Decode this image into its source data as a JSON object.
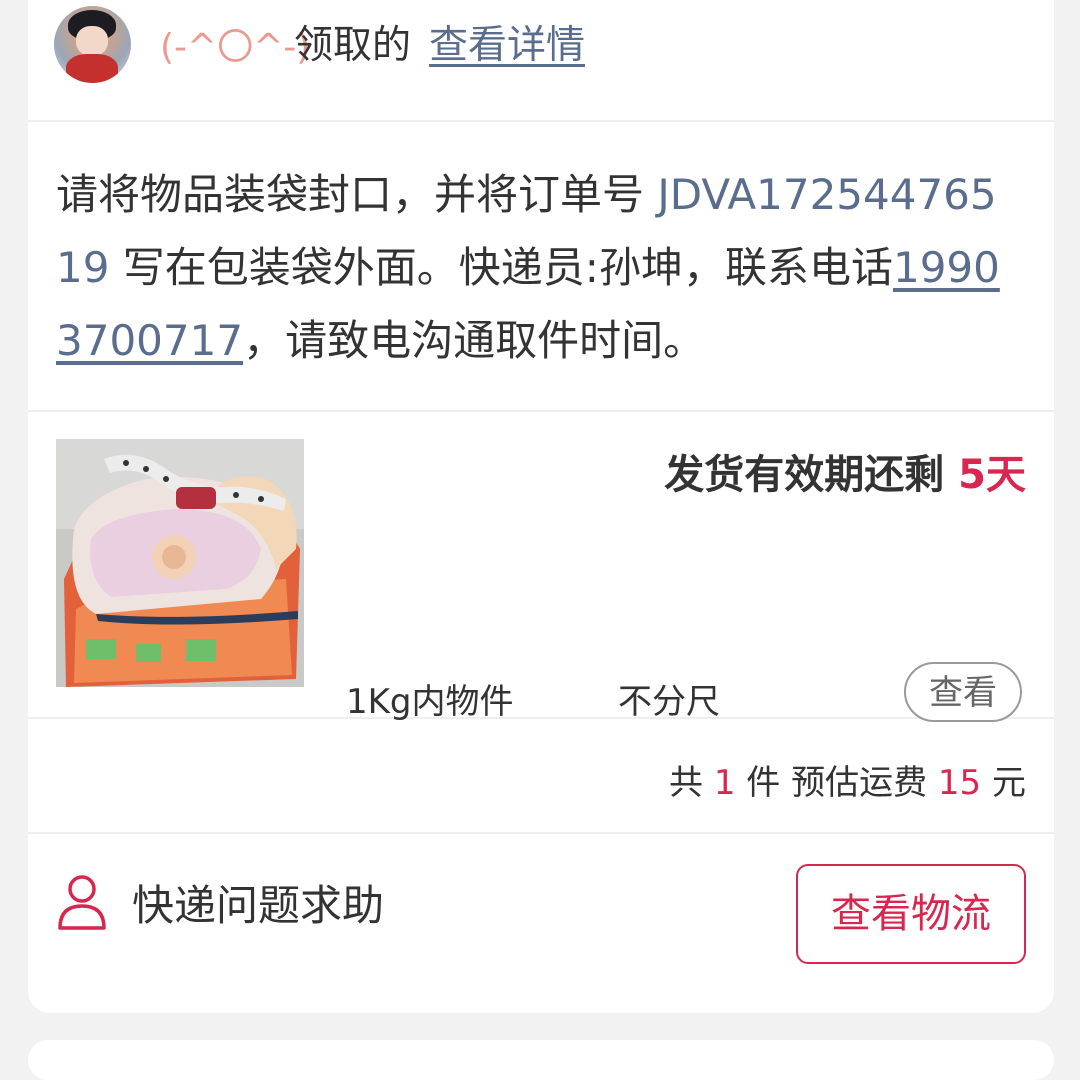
{
  "header": {
    "nickname": "(-^〇^-)",
    "received_text": "领取的",
    "view_detail_label": "查看详情"
  },
  "instruction": {
    "text_before_order": "请将物品装袋封口，并将订单号 ",
    "order_number": "JDVA17254476519",
    "text_after_order": " 写在包装袋外面。快递员:孙坤，联系电话",
    "phone": "19903700717",
    "text_after_phone": "，请致电沟通取件时间。"
  },
  "product": {
    "image_icon": "iron-photo",
    "validity_prefix": "发货有效期还剩 ",
    "validity_days": "5天",
    "weight_spec": "1Kg内物件",
    "size_spec": "不分尺",
    "view_label": "查看"
  },
  "summary": {
    "total_prefix": "共 ",
    "item_count": "1",
    "item_unit": " 件 预估运费 ",
    "freight": "15",
    "currency": " 元"
  },
  "footer": {
    "help_icon": "person-icon",
    "help_label": "快递问题求助",
    "logistics_label": "查看物流"
  },
  "colors": {
    "accent": "#d8274f",
    "link": "#5a6d8e",
    "nickname": "#e99b92"
  }
}
